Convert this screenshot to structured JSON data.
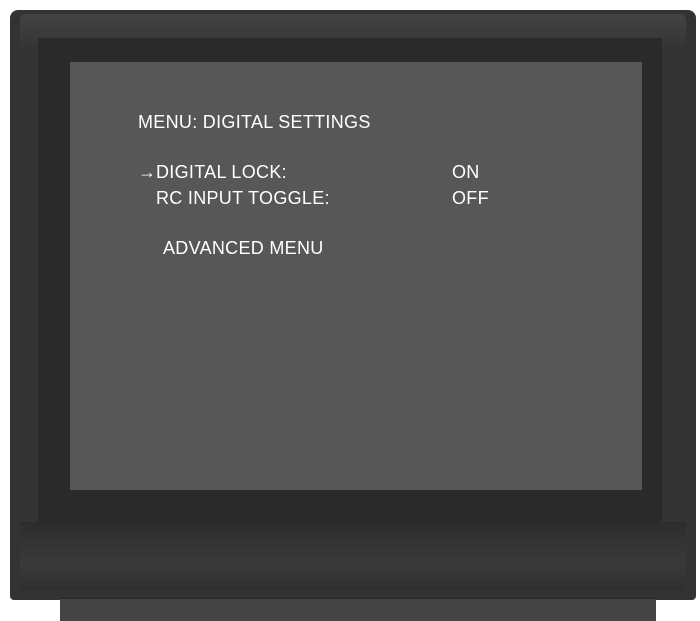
{
  "page_corner_mark": "",
  "menu": {
    "title": "MENU: DIGITAL SETTINGS",
    "selection_arrow": "→",
    "items": [
      {
        "label": "DIGITAL LOCK:",
        "value": "ON",
        "selected": true
      },
      {
        "label": "RC INPUT TOGGLE:",
        "value": "OFF",
        "selected": false
      }
    ],
    "advanced_label": "ADVANCED MENU"
  },
  "colors": {
    "screen": "#575757",
    "bezel": "#333333",
    "text": "#ffffff"
  }
}
